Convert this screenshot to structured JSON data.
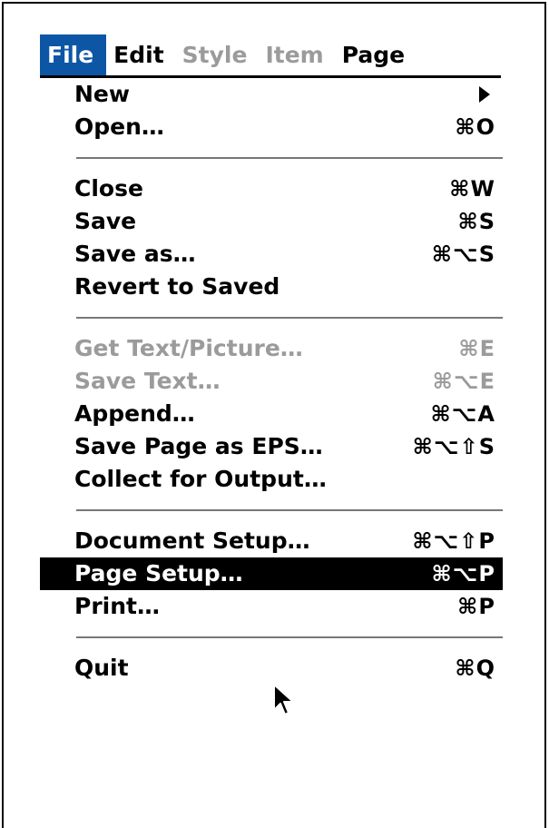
{
  "menubar": {
    "items": [
      {
        "label": "File",
        "state": "active"
      },
      {
        "label": "Edit",
        "state": "enabled"
      },
      {
        "label": "Style",
        "state": "disabled"
      },
      {
        "label": "Item",
        "state": "disabled"
      },
      {
        "label": "Page",
        "state": "enabled"
      }
    ]
  },
  "menu": {
    "new": {
      "label": "New",
      "submenu": "submenu-arrow-icon"
    },
    "open": {
      "label": "Open…",
      "shortcut": "⌘O"
    },
    "close": {
      "label": "Close",
      "shortcut": "⌘W"
    },
    "save": {
      "label": "Save",
      "shortcut": "⌘S"
    },
    "save_as": {
      "label": "Save as…",
      "shortcut": "⌘⌥S"
    },
    "revert": {
      "label": "Revert to Saved"
    },
    "get_text": {
      "label": "Get Text/Picture…",
      "shortcut": "⌘E",
      "disabled": true
    },
    "save_text": {
      "label": "Save Text…",
      "shortcut": "⌘⌥E",
      "disabled": true
    },
    "append": {
      "label": "Append…",
      "shortcut": "⌘⌥A"
    },
    "save_eps": {
      "label": "Save Page as EPS…",
      "shortcut": "⌘⌥⇧S"
    },
    "collect": {
      "label": "Collect for Output…"
    },
    "doc_setup": {
      "label": "Document Setup…",
      "shortcut": "⌘⌥⇧P"
    },
    "page_setup": {
      "label": "Page Setup…",
      "shortcut": "⌘⌥P",
      "highlighted": true
    },
    "print": {
      "label": "Print…",
      "shortcut": "⌘P"
    },
    "quit": {
      "label": "Quit",
      "shortcut": "⌘Q"
    }
  },
  "colors": {
    "menubar_active": "#0d56a6",
    "highlight": "#000000",
    "disabled_text": "#9b9b9b"
  },
  "cursor": {
    "icon": "arrow-pointer-icon"
  }
}
